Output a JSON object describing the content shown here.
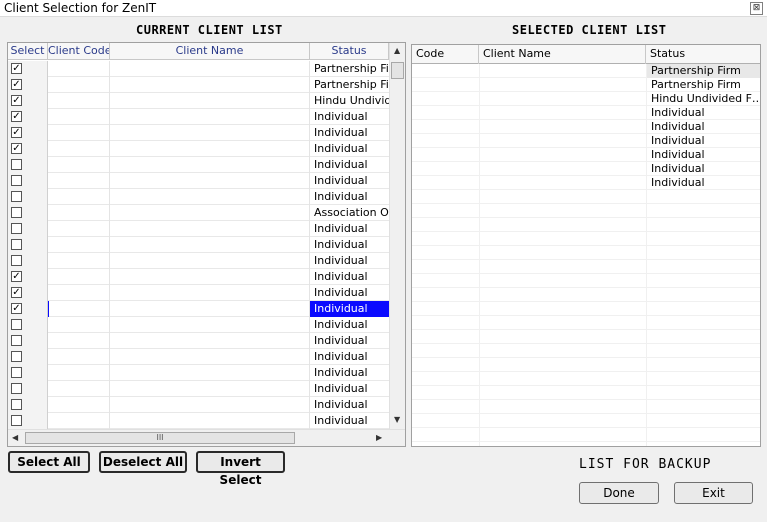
{
  "window": {
    "title": "Client Selection for ZenIT",
    "close_glyph": "⊠"
  },
  "left_panel": {
    "title": "CURRENT CLIENT LIST",
    "columns": [
      "Select",
      "Client Code",
      "Client Name",
      "Status"
    ],
    "rows": [
      {
        "checked": true,
        "status": "Partnership Firm"
      },
      {
        "checked": true,
        "status": "Partnership Firm"
      },
      {
        "checked": true,
        "status": "Hindu Undivided"
      },
      {
        "checked": true,
        "status": "Individual"
      },
      {
        "checked": true,
        "status": "Individual"
      },
      {
        "checked": true,
        "status": "Individual"
      },
      {
        "checked": false,
        "status": "Individual"
      },
      {
        "checked": false,
        "status": "Individual"
      },
      {
        "checked": false,
        "status": "Individual"
      },
      {
        "checked": false,
        "status": "Association Of P"
      },
      {
        "checked": false,
        "status": "Individual"
      },
      {
        "checked": false,
        "status": "Individual"
      },
      {
        "checked": false,
        "status": "Individual"
      },
      {
        "checked": true,
        "status": "Individual"
      },
      {
        "checked": true,
        "status": "Individual"
      },
      {
        "checked": true,
        "status": "Individual",
        "selected": true
      },
      {
        "checked": false,
        "status": "Individual"
      },
      {
        "checked": false,
        "status": "Individual"
      },
      {
        "checked": false,
        "status": "Individual"
      },
      {
        "checked": false,
        "status": "Individual"
      },
      {
        "checked": false,
        "status": "Individual"
      },
      {
        "checked": false,
        "status": "Individual"
      },
      {
        "checked": false,
        "status": "Individual"
      }
    ],
    "scroll_thumb_grip": "III"
  },
  "right_panel": {
    "title": "SELECTED CLIENT LIST",
    "columns": [
      "Code",
      "Client Name",
      "Status"
    ],
    "rows": [
      {
        "status": "Partnership Firm"
      },
      {
        "status": "Partnership Firm"
      },
      {
        "status": "Hindu Undivided F…"
      },
      {
        "status": "Individual"
      },
      {
        "status": "Individual"
      },
      {
        "status": "Individual"
      },
      {
        "status": "Individual"
      },
      {
        "status": "Individual"
      },
      {
        "status": "Individual"
      }
    ]
  },
  "buttons": {
    "select_all": "Select All",
    "deselect_all": "Deselect All",
    "invert_select": "Invert Select",
    "done": "Done",
    "exit": "Exit"
  },
  "backup_label": "LIST FOR BACKUP",
  "colors": {
    "selection": "#0a0aff",
    "header_text": "#2a3a8a"
  }
}
